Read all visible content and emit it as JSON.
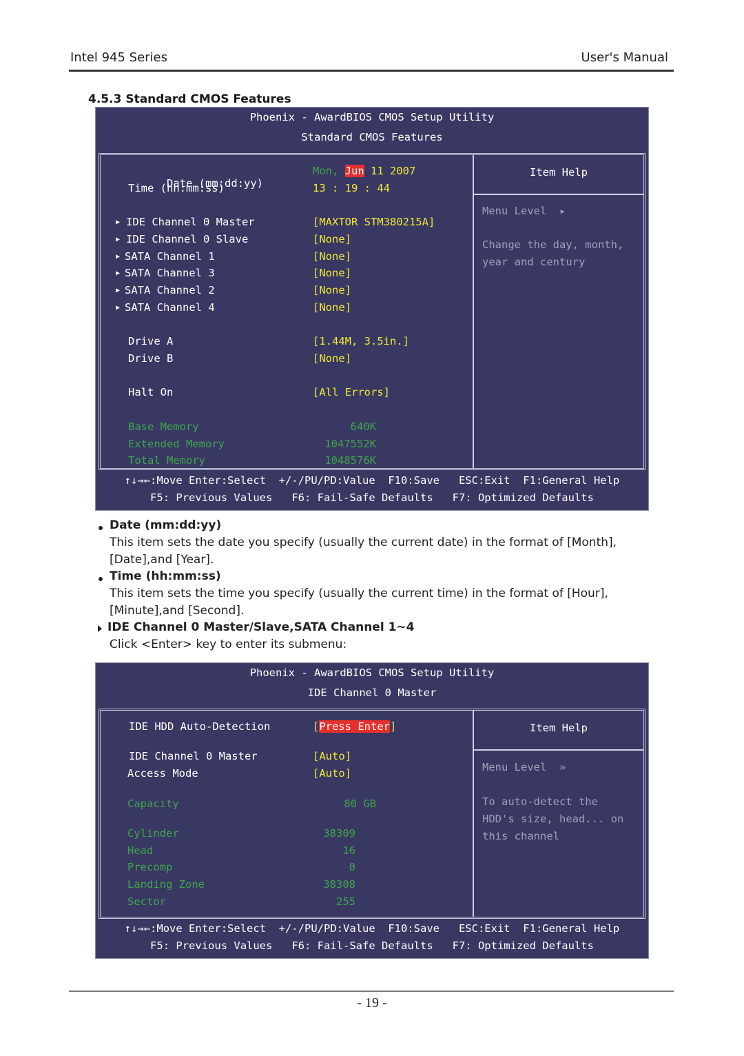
{
  "header": {
    "left": "Intel 945 Series",
    "right": "User's Manual"
  },
  "section_title": "4.5.3 Standard CMOS Features",
  "bios1": {
    "title": "Phoenix - AwardBIOS CMOS Setup Utility",
    "subtitle": "Standard CMOS Features",
    "date": {
      "label": "Date (mm:dd:yy)",
      "day": "Mon,",
      "month": "Jun",
      "rest": " 11 2007"
    },
    "time": {
      "label": "Time (hh:mm:ss)",
      "value": "13 : 19 : 44"
    },
    "submenus": [
      {
        "label": "IDE Channel 0 Master",
        "value": "[MAXTOR STM380215A]"
      },
      {
        "label": "IDE Channel 0 Slave",
        "value": "[None]"
      },
      {
        "label": "SATA Channel 1",
        "value": "[None]"
      },
      {
        "label": "SATA Channel 3",
        "value": "[None]"
      },
      {
        "label": "SATA Channel 2",
        "value": "[None]"
      },
      {
        "label": "SATA Channel 4",
        "value": "[None]"
      }
    ],
    "drives": [
      {
        "label": "Drive A",
        "value": "[1.44M, 3.5in.]"
      },
      {
        "label": "Drive B",
        "value": "[None]"
      }
    ],
    "halt": {
      "label": "Halt On",
      "value": "[All Errors]"
    },
    "memory": [
      {
        "label": "Base Memory",
        "value": "640K"
      },
      {
        "label": "Extended Memory",
        "value": "1047552K"
      },
      {
        "label": "Total Memory",
        "value": "1048576K"
      }
    ],
    "help": {
      "heading": "Item Help",
      "menu_level": "Menu Level  ▸",
      "text": "Change the day, month,\nyear and century"
    },
    "footer": {
      "line1": "↑↓→←:Move Enter:Select  +/-/PU/PD:Value  F10:Save   ESC:Exit  F1:General Help",
      "line2": "F5: Previous Values   F6: Fail-Safe Defaults   F7: Optimized Defaults"
    }
  },
  "descriptions": {
    "date_heading": "Date (mm:dd:yy)",
    "date_text1": "This item sets the date you specify (usually the current date) in the format of [Month],",
    "date_text2": "[Date],and [Year].",
    "time_heading": "Time (hh:mm:ss)",
    "time_text1": "This item sets the time you specify (usually the current time) in the format of [Hour],",
    "time_text2": "[Minute],and [Second].",
    "ide_heading": "IDE Channel 0 Master/Slave,SATA Channel 1~4",
    "ide_text": "Click <Enter> key to enter its submenu:"
  },
  "bios2": {
    "title": "Phoenix - AwardBIOS CMOS Setup Utility",
    "subtitle": "IDE Channel 0 Master",
    "autodetect": {
      "label": "IDE HDD Auto-Detection",
      "bracket_open": "[",
      "value": "Press Enter",
      "bracket_close": "]"
    },
    "channel": {
      "label": "IDE Channel 0 Master",
      "value": "[Auto]"
    },
    "access": {
      "label": "Access Mode",
      "value": "[Auto]"
    },
    "capacity": {
      "label": "Capacity",
      "value": "80 GB"
    },
    "geometry": [
      {
        "label": "Cylinder",
        "value": "38309"
      },
      {
        "label": "Head",
        "value": "16"
      },
      {
        "label": "Precomp",
        "value": "0"
      },
      {
        "label": "Landing Zone",
        "value": "38308"
      },
      {
        "label": "Sector",
        "value": "255"
      }
    ],
    "help": {
      "heading": "Item Help",
      "menu_level": "Menu Level  »",
      "text": "To auto-detect the\nHDD's size, head... on\nthis channel"
    },
    "footer": {
      "line1": "↑↓→←:Move Enter:Select  +/-/PU/PD:Value  F10:Save   ESC:Exit  F1:General Help",
      "line2": "F5: Previous Values   F6: Fail-Safe Defaults   F7: Optimized Defaults"
    }
  },
  "page_number": "- 19 -"
}
